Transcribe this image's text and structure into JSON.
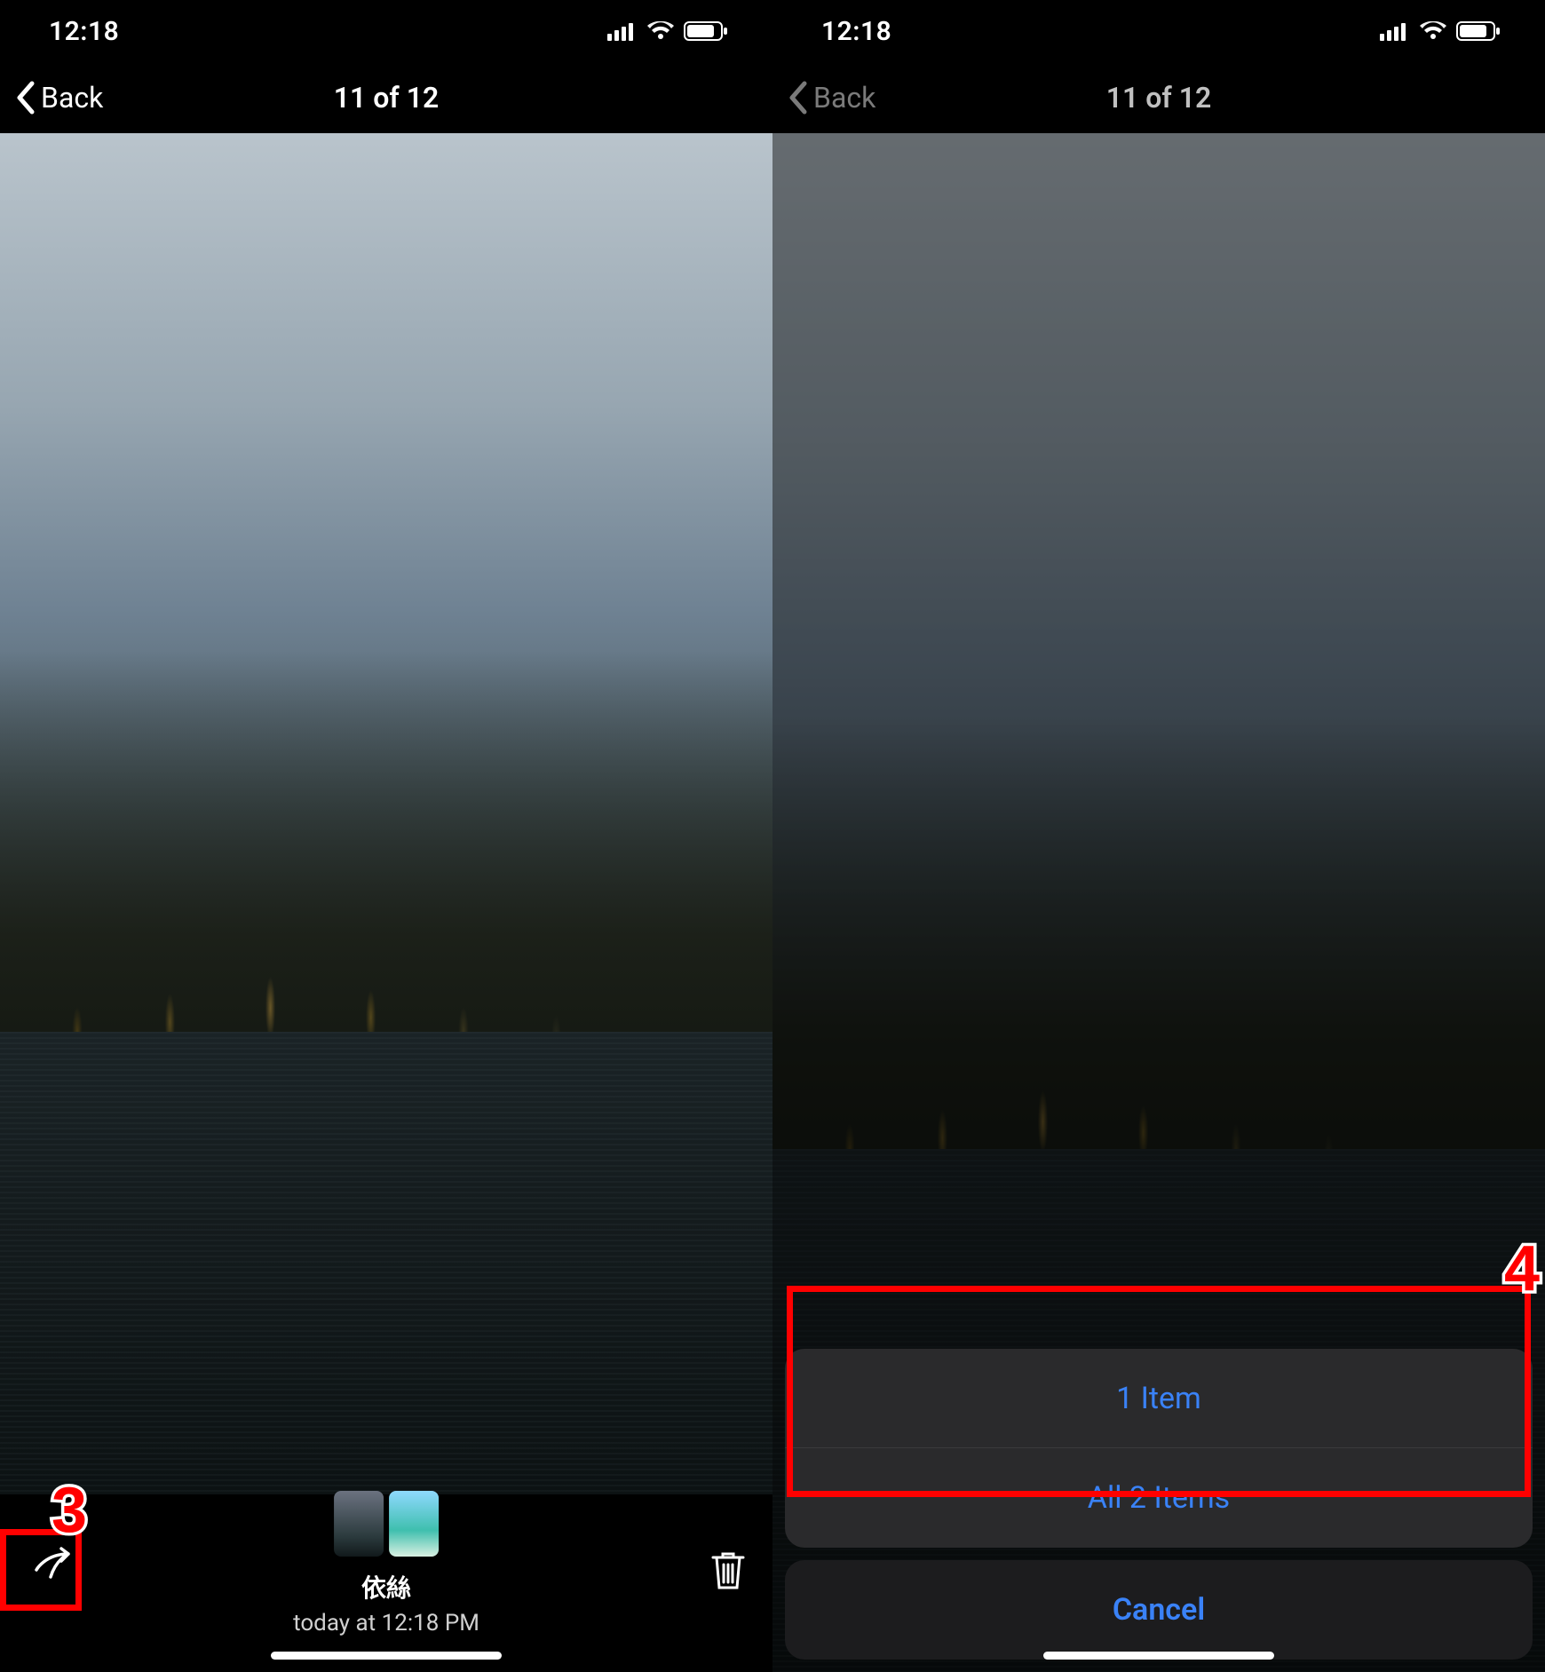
{
  "status": {
    "time": "12:18"
  },
  "left": {
    "nav": {
      "back": "Back",
      "title": "11 of 12"
    },
    "caption": {
      "name": "依絲",
      "sub": "today at 12:18 PM"
    },
    "annotation": "3"
  },
  "right": {
    "nav": {
      "back": "Back",
      "title": "11 of 12"
    },
    "sheet": {
      "options": [
        "1 Item",
        "All 2 Items"
      ],
      "cancel": "Cancel"
    },
    "annotation": "4"
  }
}
